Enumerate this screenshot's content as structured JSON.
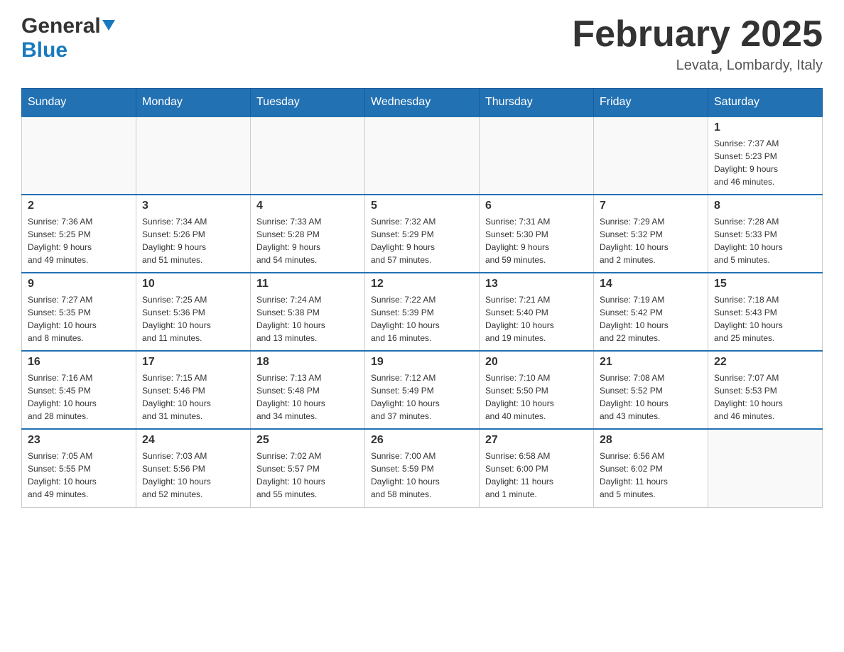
{
  "header": {
    "logo_general": "General",
    "logo_blue": "Blue",
    "month_title": "February 2025",
    "location": "Levata, Lombardy, Italy"
  },
  "days_of_week": [
    "Sunday",
    "Monday",
    "Tuesday",
    "Wednesday",
    "Thursday",
    "Friday",
    "Saturday"
  ],
  "weeks": [
    {
      "days": [
        {
          "num": "",
          "info": ""
        },
        {
          "num": "",
          "info": ""
        },
        {
          "num": "",
          "info": ""
        },
        {
          "num": "",
          "info": ""
        },
        {
          "num": "",
          "info": ""
        },
        {
          "num": "",
          "info": ""
        },
        {
          "num": "1",
          "info": "Sunrise: 7:37 AM\nSunset: 5:23 PM\nDaylight: 9 hours\nand 46 minutes."
        }
      ]
    },
    {
      "days": [
        {
          "num": "2",
          "info": "Sunrise: 7:36 AM\nSunset: 5:25 PM\nDaylight: 9 hours\nand 49 minutes."
        },
        {
          "num": "3",
          "info": "Sunrise: 7:34 AM\nSunset: 5:26 PM\nDaylight: 9 hours\nand 51 minutes."
        },
        {
          "num": "4",
          "info": "Sunrise: 7:33 AM\nSunset: 5:28 PM\nDaylight: 9 hours\nand 54 minutes."
        },
        {
          "num": "5",
          "info": "Sunrise: 7:32 AM\nSunset: 5:29 PM\nDaylight: 9 hours\nand 57 minutes."
        },
        {
          "num": "6",
          "info": "Sunrise: 7:31 AM\nSunset: 5:30 PM\nDaylight: 9 hours\nand 59 minutes."
        },
        {
          "num": "7",
          "info": "Sunrise: 7:29 AM\nSunset: 5:32 PM\nDaylight: 10 hours\nand 2 minutes."
        },
        {
          "num": "8",
          "info": "Sunrise: 7:28 AM\nSunset: 5:33 PM\nDaylight: 10 hours\nand 5 minutes."
        }
      ]
    },
    {
      "days": [
        {
          "num": "9",
          "info": "Sunrise: 7:27 AM\nSunset: 5:35 PM\nDaylight: 10 hours\nand 8 minutes."
        },
        {
          "num": "10",
          "info": "Sunrise: 7:25 AM\nSunset: 5:36 PM\nDaylight: 10 hours\nand 11 minutes."
        },
        {
          "num": "11",
          "info": "Sunrise: 7:24 AM\nSunset: 5:38 PM\nDaylight: 10 hours\nand 13 minutes."
        },
        {
          "num": "12",
          "info": "Sunrise: 7:22 AM\nSunset: 5:39 PM\nDaylight: 10 hours\nand 16 minutes."
        },
        {
          "num": "13",
          "info": "Sunrise: 7:21 AM\nSunset: 5:40 PM\nDaylight: 10 hours\nand 19 minutes."
        },
        {
          "num": "14",
          "info": "Sunrise: 7:19 AM\nSunset: 5:42 PM\nDaylight: 10 hours\nand 22 minutes."
        },
        {
          "num": "15",
          "info": "Sunrise: 7:18 AM\nSunset: 5:43 PM\nDaylight: 10 hours\nand 25 minutes."
        }
      ]
    },
    {
      "days": [
        {
          "num": "16",
          "info": "Sunrise: 7:16 AM\nSunset: 5:45 PM\nDaylight: 10 hours\nand 28 minutes."
        },
        {
          "num": "17",
          "info": "Sunrise: 7:15 AM\nSunset: 5:46 PM\nDaylight: 10 hours\nand 31 minutes."
        },
        {
          "num": "18",
          "info": "Sunrise: 7:13 AM\nSunset: 5:48 PM\nDaylight: 10 hours\nand 34 minutes."
        },
        {
          "num": "19",
          "info": "Sunrise: 7:12 AM\nSunset: 5:49 PM\nDaylight: 10 hours\nand 37 minutes."
        },
        {
          "num": "20",
          "info": "Sunrise: 7:10 AM\nSunset: 5:50 PM\nDaylight: 10 hours\nand 40 minutes."
        },
        {
          "num": "21",
          "info": "Sunrise: 7:08 AM\nSunset: 5:52 PM\nDaylight: 10 hours\nand 43 minutes."
        },
        {
          "num": "22",
          "info": "Sunrise: 7:07 AM\nSunset: 5:53 PM\nDaylight: 10 hours\nand 46 minutes."
        }
      ]
    },
    {
      "days": [
        {
          "num": "23",
          "info": "Sunrise: 7:05 AM\nSunset: 5:55 PM\nDaylight: 10 hours\nand 49 minutes."
        },
        {
          "num": "24",
          "info": "Sunrise: 7:03 AM\nSunset: 5:56 PM\nDaylight: 10 hours\nand 52 minutes."
        },
        {
          "num": "25",
          "info": "Sunrise: 7:02 AM\nSunset: 5:57 PM\nDaylight: 10 hours\nand 55 minutes."
        },
        {
          "num": "26",
          "info": "Sunrise: 7:00 AM\nSunset: 5:59 PM\nDaylight: 10 hours\nand 58 minutes."
        },
        {
          "num": "27",
          "info": "Sunrise: 6:58 AM\nSunset: 6:00 PM\nDaylight: 11 hours\nand 1 minute."
        },
        {
          "num": "28",
          "info": "Sunrise: 6:56 AM\nSunset: 6:02 PM\nDaylight: 11 hours\nand 5 minutes."
        },
        {
          "num": "",
          "info": ""
        }
      ]
    }
  ]
}
